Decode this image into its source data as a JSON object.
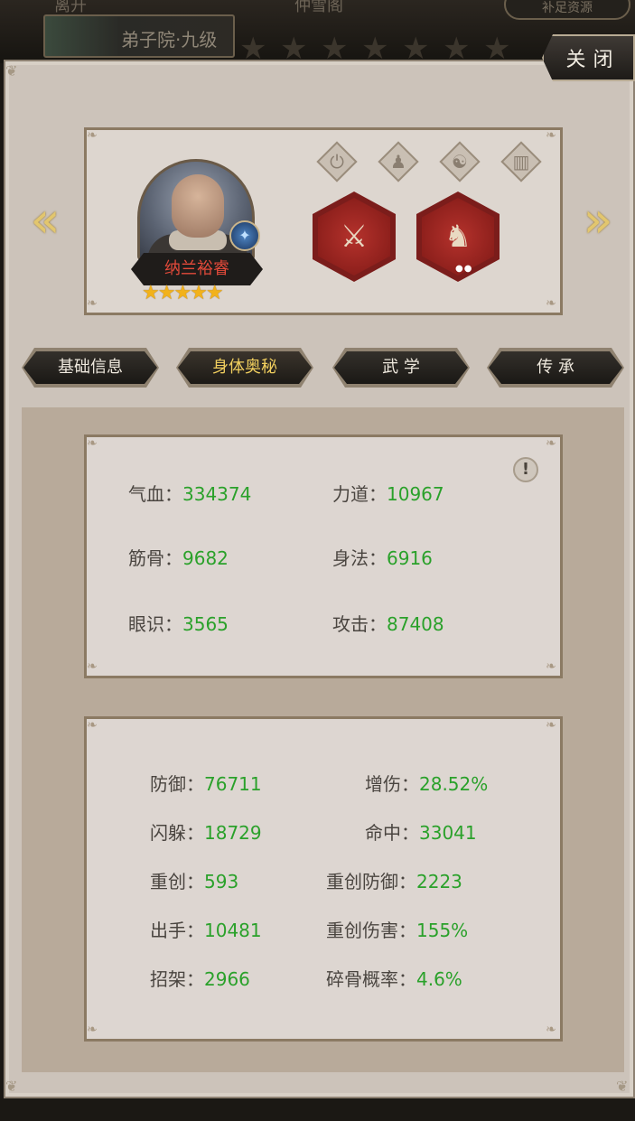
{
  "background": {
    "top_labels": [
      "离开",
      "仲雪阁"
    ],
    "chip_label": "弟子院·九级",
    "pill_label": "补足资源"
  },
  "close_label": "关闭",
  "hero": {
    "name": "纳兰裕睿",
    "stars": "★★★★★",
    "name_color": "#e34a3a"
  },
  "tabs": [
    {
      "label": "基础信息"
    },
    {
      "label": "身体奥秘"
    },
    {
      "label": "武 学"
    },
    {
      "label": "传 承"
    }
  ],
  "primary_stats": [
    {
      "key": "气血：",
      "value": "334374"
    },
    {
      "key": "力道：",
      "value": "10967"
    },
    {
      "key": "筋骨：",
      "value": "9682"
    },
    {
      "key": "身法：",
      "value": "6916"
    },
    {
      "key": "眼识：",
      "value": "3565"
    },
    {
      "key": "攻击：",
      "value": "87408"
    }
  ],
  "info_mark": "!",
  "secondary_stats": [
    {
      "key": "防御：",
      "value": "76711"
    },
    {
      "key": "增伤：",
      "value": "28.52%"
    },
    {
      "key": "闪躲：",
      "value": "18729"
    },
    {
      "key": "命中：",
      "value": "33041"
    },
    {
      "key": "重创：",
      "value": "593"
    },
    {
      "key": "重创防御：",
      "value": "2223"
    },
    {
      "key": "出手：",
      "value": "10481"
    },
    {
      "key": "重创伤害：",
      "value": "155%"
    },
    {
      "key": "招架：",
      "value": "2966"
    },
    {
      "key": "碎骨概率：",
      "value": "4.6%"
    }
  ],
  "colors": {
    "panel": "#ccc3ba",
    "value_green": "#2aa12a",
    "active_tab": "#f1cf5e"
  }
}
